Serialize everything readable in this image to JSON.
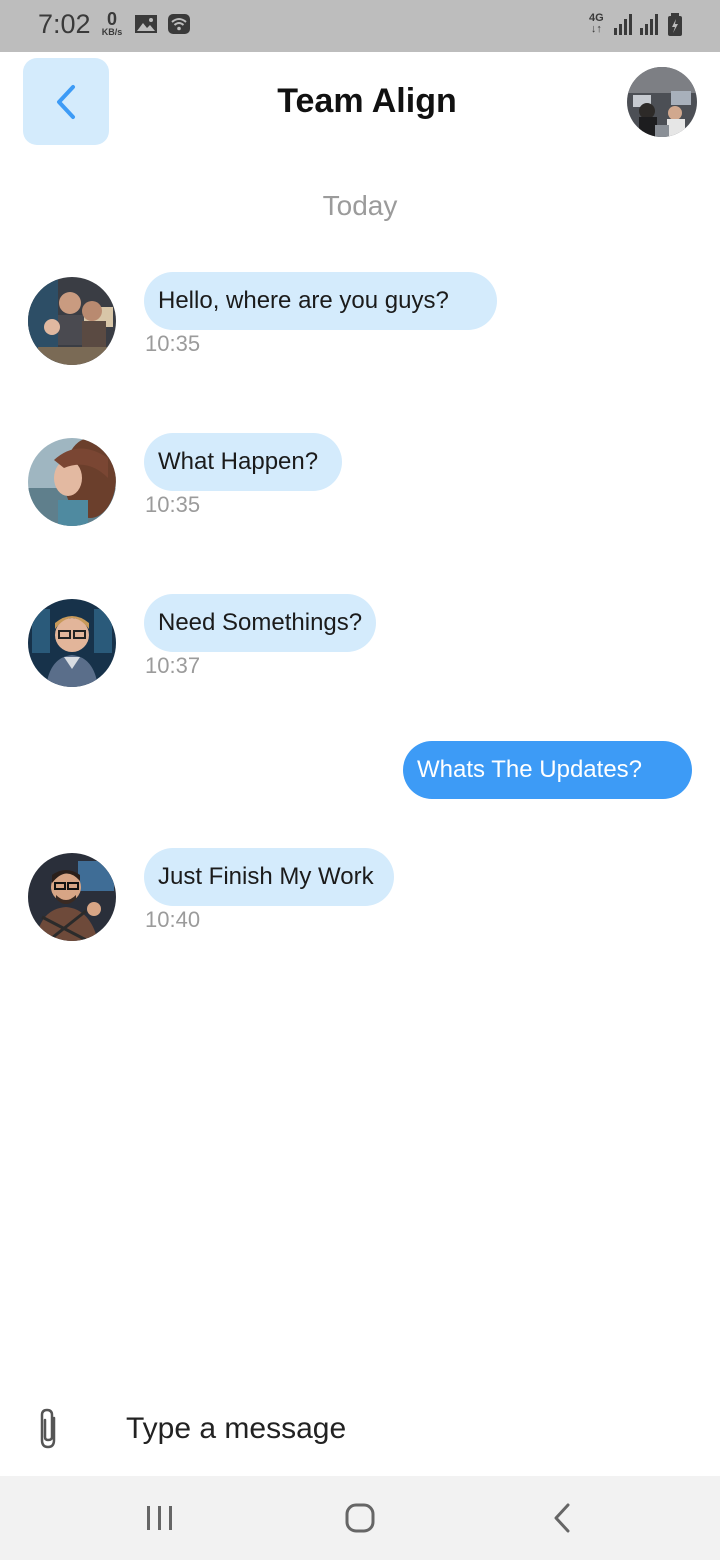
{
  "status_bar": {
    "time": "7:02",
    "net_speed_value": "0",
    "net_speed_unit": "KB/s",
    "network_type": "4G"
  },
  "header": {
    "title": "Team Align",
    "back_icon": "chevron-left-icon",
    "group_avatar": "group-photo"
  },
  "day_label": "Today",
  "messages": [
    {
      "sender": "other",
      "text": "Hello, where are you guys?",
      "time": "10:35"
    },
    {
      "sender": "other",
      "text": "What Happen?",
      "time": "10:35"
    },
    {
      "sender": "other",
      "text": "Need Somethings?",
      "time": "10:37"
    },
    {
      "sender": "me",
      "text": "Whats The Updates?"
    },
    {
      "sender": "other",
      "text": "Just Finish My Work",
      "time": "10:40"
    }
  ],
  "composer": {
    "placeholder": "Type a message",
    "attach_icon": "paperclip-icon"
  },
  "colors": {
    "accent": "#3d9bf6",
    "bubble_incoming": "#d4ebfc",
    "status_bar": "#bdbdbd",
    "timestamp": "#9b9b9b"
  }
}
